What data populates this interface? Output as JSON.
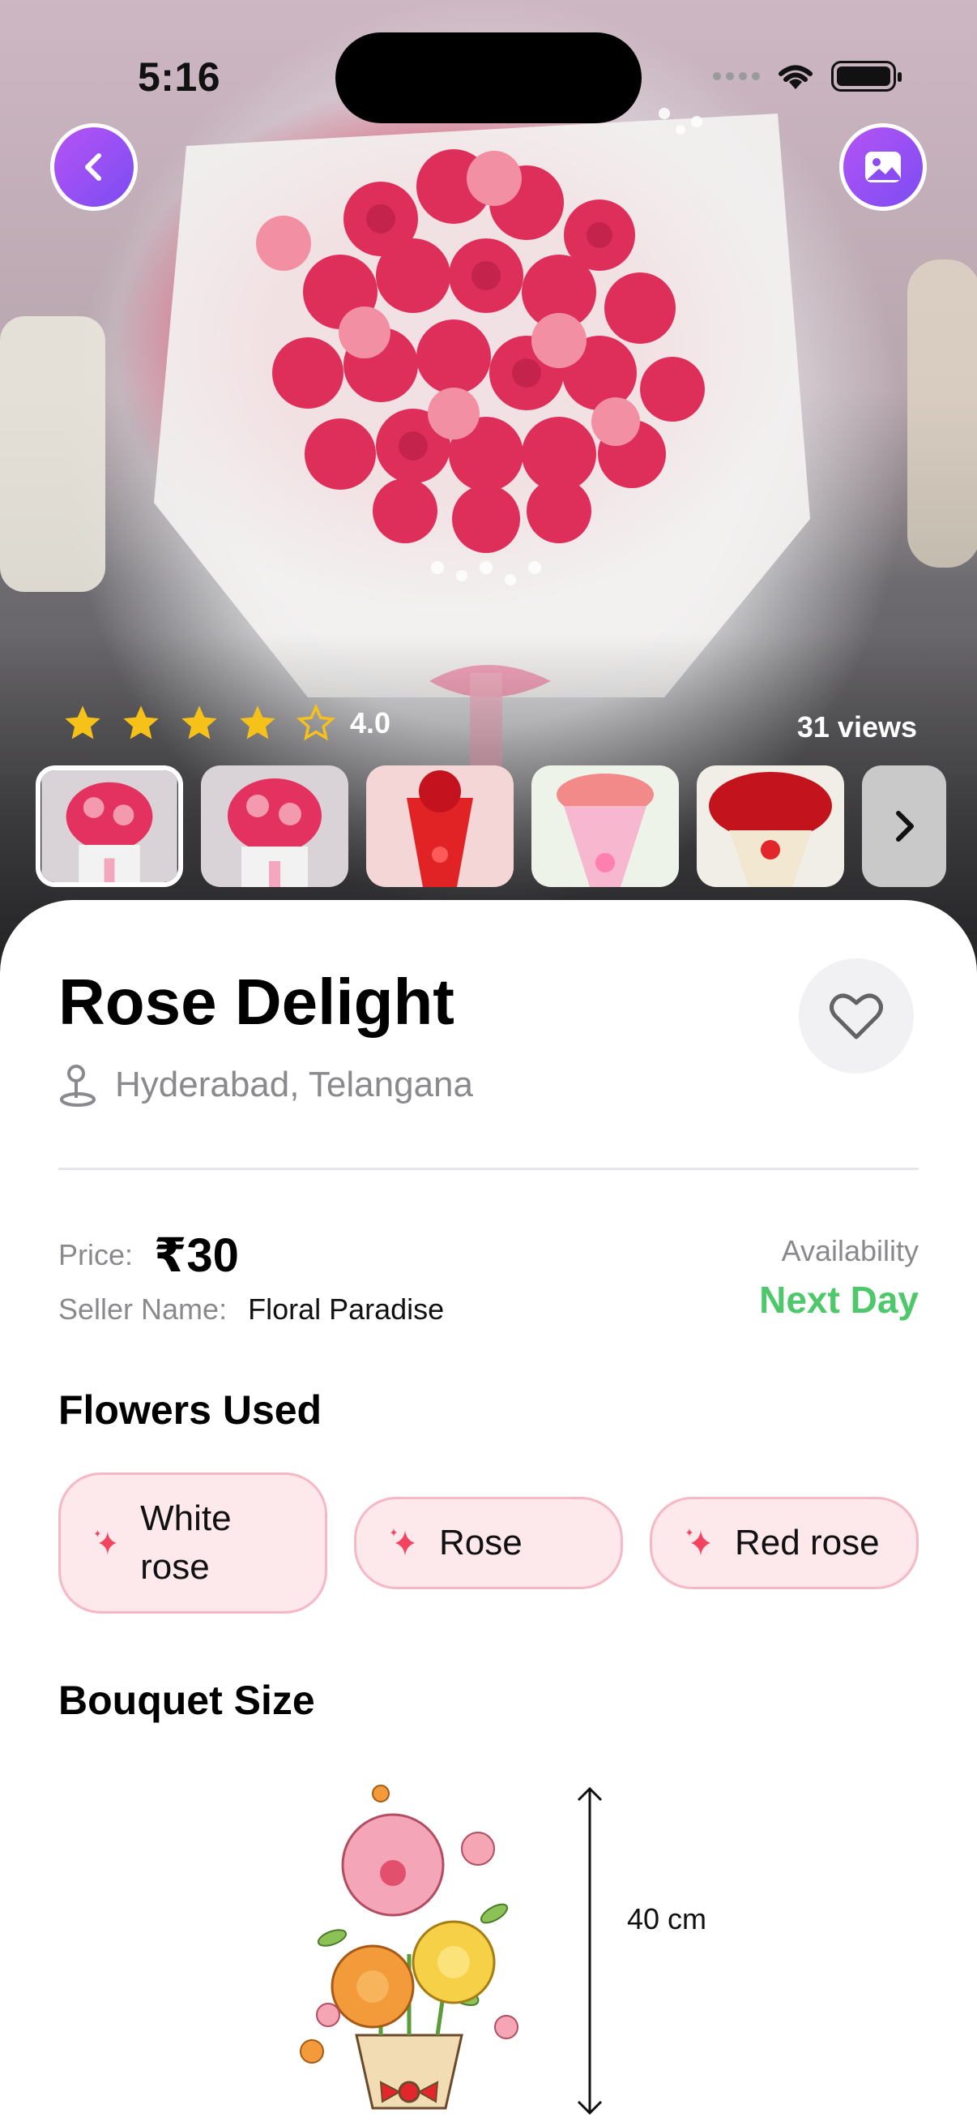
{
  "status_bar": {
    "time": "5:16"
  },
  "hero": {
    "rating": {
      "value": "4.0",
      "stars_filled": 4,
      "stars_total": 5
    },
    "views": "31 views",
    "thumbnails": [
      "Rose bouquet",
      "Rose bouquet",
      "Red bouquet",
      "Pink bouquet",
      "Red rose basket"
    ]
  },
  "product": {
    "title": "Rose Delight",
    "location": "Hyderabad, Telangana",
    "price_label": "Price:",
    "price": "₹30",
    "seller_label": "Seller Name:",
    "seller": "Floral Paradise",
    "availability_label": "Availability",
    "availability": "Next Day"
  },
  "flowers_used": {
    "title": "Flowers Used",
    "items": [
      "White rose",
      "Rose",
      "Red rose"
    ]
  },
  "bouquet_size": {
    "title": "Bouquet Size",
    "height": "40 cm"
  },
  "colors": {
    "accent_purple": "#8b4df2",
    "availability_green": "#4fc86b",
    "chip_bg": "#fde8ec",
    "chip_border": "#f5b8c4",
    "star_yellow": "#f6c21a"
  }
}
